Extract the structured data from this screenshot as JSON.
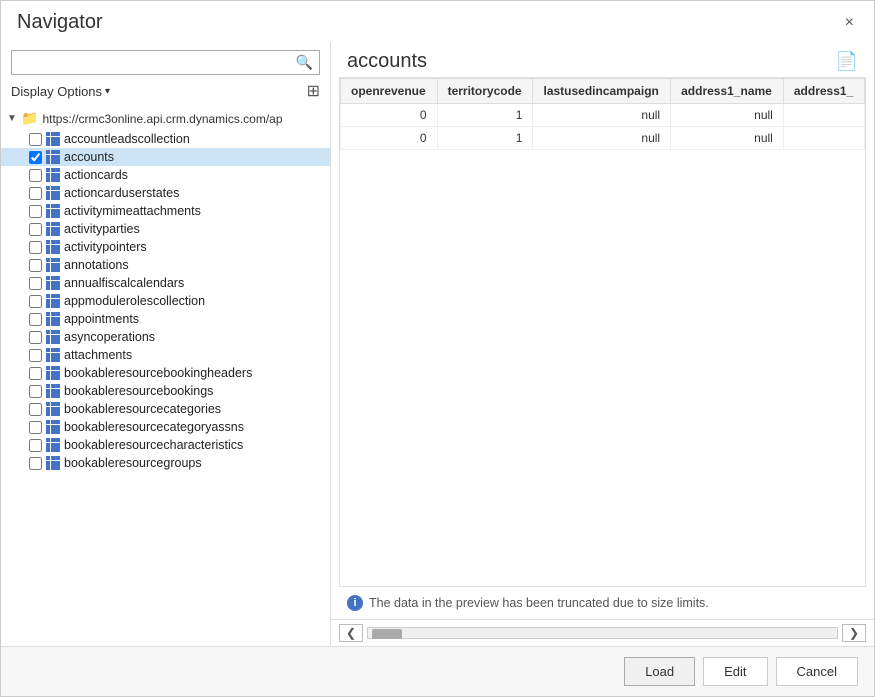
{
  "dialog": {
    "title": "Navigator",
    "close_label": "×"
  },
  "search": {
    "placeholder": "",
    "value": ""
  },
  "display_options": {
    "label": "Display Options",
    "arrow": "▾"
  },
  "tree": {
    "root_url": "https://crmc3online.api.crm.dynamics.com/ap",
    "items": [
      {
        "id": "accountleadscollection",
        "label": "accountleadscollection",
        "checked": false,
        "selected": false
      },
      {
        "id": "accounts",
        "label": "accounts",
        "checked": true,
        "selected": true
      },
      {
        "id": "actioncards",
        "label": "actioncards",
        "checked": false,
        "selected": false
      },
      {
        "id": "actioncarduserstates",
        "label": "actioncarduserstates",
        "checked": false,
        "selected": false
      },
      {
        "id": "activitymimeattachments",
        "label": "activitymimeattachments",
        "checked": false,
        "selected": false
      },
      {
        "id": "activityparties",
        "label": "activityparties",
        "checked": false,
        "selected": false
      },
      {
        "id": "activitypointers",
        "label": "activitypointers",
        "checked": false,
        "selected": false
      },
      {
        "id": "annotations",
        "label": "annotations",
        "checked": false,
        "selected": false
      },
      {
        "id": "annualfiscalcalendars",
        "label": "annualfiscalcalendars",
        "checked": false,
        "selected": false
      },
      {
        "id": "appmodulerolescollection",
        "label": "appmodulerolescollection",
        "checked": false,
        "selected": false
      },
      {
        "id": "appointments",
        "label": "appointments",
        "checked": false,
        "selected": false
      },
      {
        "id": "asyncoperations",
        "label": "asyncoperations",
        "checked": false,
        "selected": false
      },
      {
        "id": "attachments",
        "label": "attachments",
        "checked": false,
        "selected": false
      },
      {
        "id": "bookableresourcebookingheaders",
        "label": "bookableresourcebookingheaders",
        "checked": false,
        "selected": false
      },
      {
        "id": "bookableresourcebookings",
        "label": "bookableresourcebookings",
        "checked": false,
        "selected": false
      },
      {
        "id": "bookableresourcecategories",
        "label": "bookableresourcecategories",
        "checked": false,
        "selected": false
      },
      {
        "id": "bookableresourcecategoryassns",
        "label": "bookableresourcecategoryassns",
        "checked": false,
        "selected": false
      },
      {
        "id": "bookableresourcecharacteristics",
        "label": "bookableresourcecharacteristics",
        "checked": false,
        "selected": false
      },
      {
        "id": "bookableresourcegroups",
        "label": "bookableresourcegroups",
        "checked": false,
        "selected": false
      }
    ]
  },
  "preview": {
    "title": "accounts",
    "columns": [
      "openrevenue",
      "territorycode",
      "lastusedincampaign",
      "address1_name",
      "address1_"
    ],
    "rows": [
      [
        "0",
        "1",
        "null",
        "null",
        ""
      ],
      [
        "0",
        "1",
        "null",
        "null",
        ""
      ]
    ],
    "truncated_message": "The data in the preview has been truncated due to size limits."
  },
  "footer": {
    "load_label": "Load",
    "edit_label": "Edit",
    "cancel_label": "Cancel"
  },
  "icons": {
    "search": "🔍",
    "display": "⊞",
    "folder": "📁",
    "file_export": "📄",
    "info": "i",
    "chevron_left": "❮",
    "chevron_right": "❯",
    "expand": "▶",
    "collapse": "▼"
  }
}
